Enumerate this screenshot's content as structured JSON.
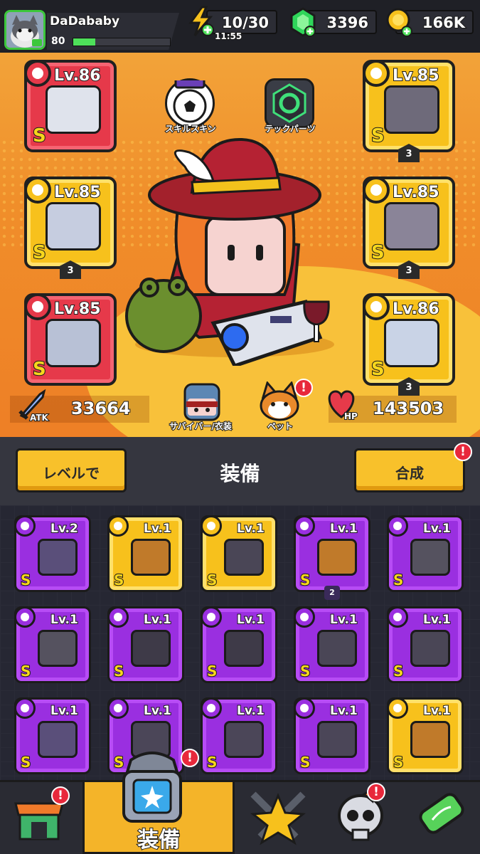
{
  "player": {
    "name": "DaDababy",
    "level": "80",
    "xp_fraction": 0.23
  },
  "resources": {
    "energy": "10/30",
    "energy_timer": "11:55",
    "gems": "3396",
    "gold": "166K"
  },
  "hero": {
    "skill_skin_label": "スキルスキン",
    "tech_parts_label": "テックパーツ",
    "survivor_label": "サバイバー/衣装",
    "pet_label": "ペット",
    "atk_label": "ATK",
    "atk_value": "33664",
    "hp_label": "HP",
    "hp_value": "143503"
  },
  "equipped": [
    {
      "slot": "weapon",
      "level": "Lv.86",
      "rank": "S",
      "stars": "",
      "color": "red"
    },
    {
      "slot": "necklace",
      "level": "Lv.85",
      "rank": "S",
      "stars": "3",
      "color": "yellow"
    },
    {
      "slot": "gloves",
      "level": "Lv.85",
      "rank": "S",
      "stars": "",
      "color": "red"
    },
    {
      "slot": "armor",
      "level": "Lv.85",
      "rank": "S",
      "stars": "3",
      "color": "yellow"
    },
    {
      "slot": "belt",
      "level": "Lv.85",
      "rank": "S",
      "stars": "3",
      "color": "yellow"
    },
    {
      "slot": "boots",
      "level": "Lv.86",
      "rank": "S",
      "stars": "3",
      "color": "yellow"
    }
  ],
  "equip_bar": {
    "level_button": "レベルで",
    "title": "装備",
    "merge_button": "合成"
  },
  "inventory": [
    {
      "type": "gloves-icon",
      "level": "Lv.2",
      "rank": "S",
      "stars": "",
      "color": "purple"
    },
    {
      "type": "weapon-icon",
      "level": "Lv.1",
      "rank": "S",
      "stars": "",
      "color": "yellow"
    },
    {
      "type": "belt-icon",
      "level": "Lv.1",
      "rank": "S",
      "stars": "",
      "color": "yellow"
    },
    {
      "type": "weapon-icon",
      "level": "Lv.1",
      "rank": "S",
      "stars": "2",
      "color": "purple"
    },
    {
      "type": "armor-icon",
      "level": "Lv.1",
      "rank": "S",
      "stars": "",
      "color": "purple"
    },
    {
      "type": "armor-icon",
      "level": "Lv.1",
      "rank": "S",
      "stars": "",
      "color": "purple"
    },
    {
      "type": "necklace-icon",
      "level": "Lv.1",
      "rank": "S",
      "stars": "",
      "color": "purple"
    },
    {
      "type": "necklace-icon",
      "level": "Lv.1",
      "rank": "S",
      "stars": "",
      "color": "purple"
    },
    {
      "type": "belt-icon",
      "level": "Lv.1",
      "rank": "S",
      "stars": "",
      "color": "purple"
    },
    {
      "type": "belt-icon",
      "level": "Lv.1",
      "rank": "S",
      "stars": "",
      "color": "purple"
    },
    {
      "type": "gloves-icon",
      "level": "Lv.1",
      "rank": "S",
      "stars": "",
      "color": "purple"
    },
    {
      "type": "boots-icon",
      "level": "Lv.1",
      "rank": "S",
      "stars": "",
      "color": "purple"
    },
    {
      "type": "boots-icon",
      "level": "Lv.1",
      "rank": "S",
      "stars": "",
      "color": "purple"
    },
    {
      "type": "boots-icon",
      "level": "Lv.1",
      "rank": "S",
      "stars": "",
      "color": "purple"
    },
    {
      "type": "weapon-icon",
      "level": "Lv.1",
      "rank": "S",
      "stars": "",
      "color": "yellow"
    }
  ],
  "nav": {
    "equip_label": "装備",
    "badge": "!"
  },
  "colors": {
    "accent_orange": "#f08e2a",
    "item_purple": "#9a2fe0",
    "item_yellow": "#f7c11c",
    "slot_red": "#e6394a",
    "badge_red": "#e8283b"
  }
}
